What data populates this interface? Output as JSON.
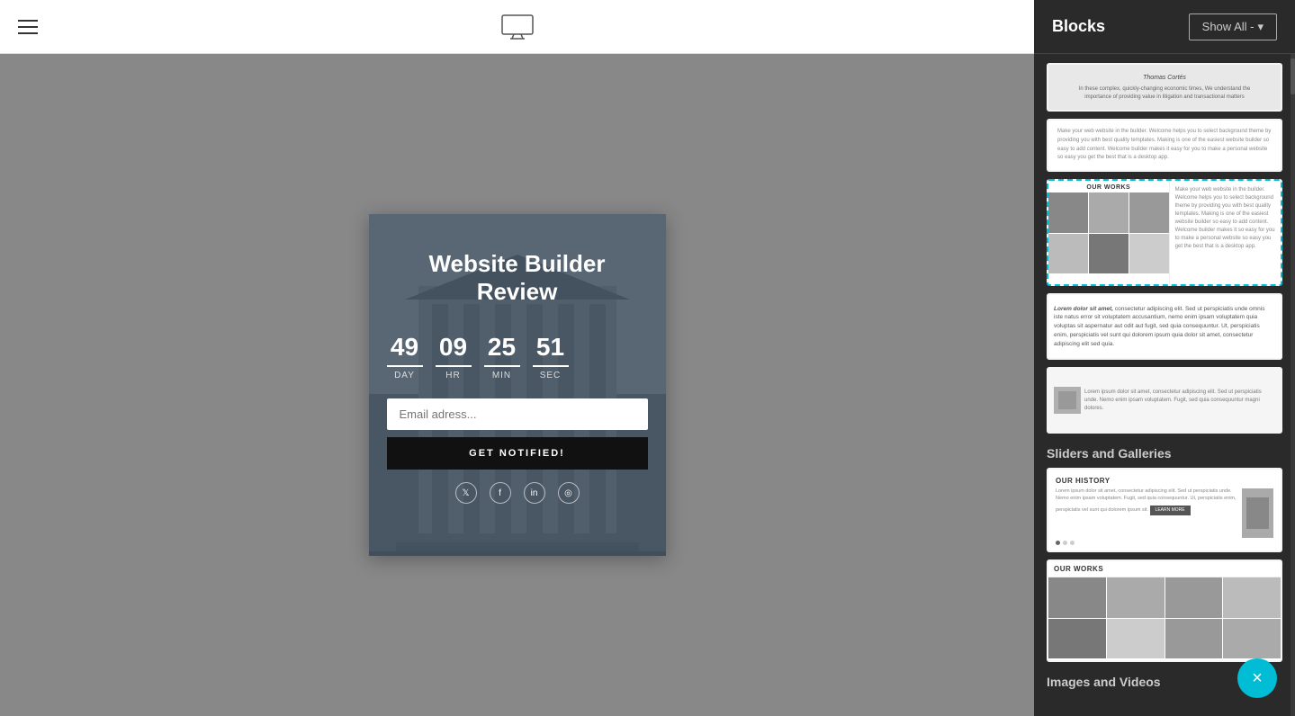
{
  "toolbar": {
    "hamburger_label": "menu",
    "monitor_icon": "monitor"
  },
  "panel": {
    "title": "Blocks",
    "show_all_label": "Show All -",
    "sections": {
      "sliders_and_galleries": "Sliders and Galleries",
      "images_and_videos": "Images and Videos"
    }
  },
  "preview": {
    "title": "Website Builder\nReview",
    "countdown": {
      "days": "49",
      "hours": "09",
      "minutes": "25",
      "seconds": "51",
      "day_label": "DAY",
      "hr_label": "HR",
      "min_label": "MIN",
      "sec_label": "SEC"
    },
    "email_placeholder": "Email adress...",
    "notify_button": "GET NOTIFIED!"
  },
  "blocks": {
    "selected_block_title": "OUR WORKS",
    "history_title": "OUR HISTORY",
    "history_btn": "LEARN MORE",
    "works_title": "OUR WORKS"
  },
  "close_button": "×"
}
